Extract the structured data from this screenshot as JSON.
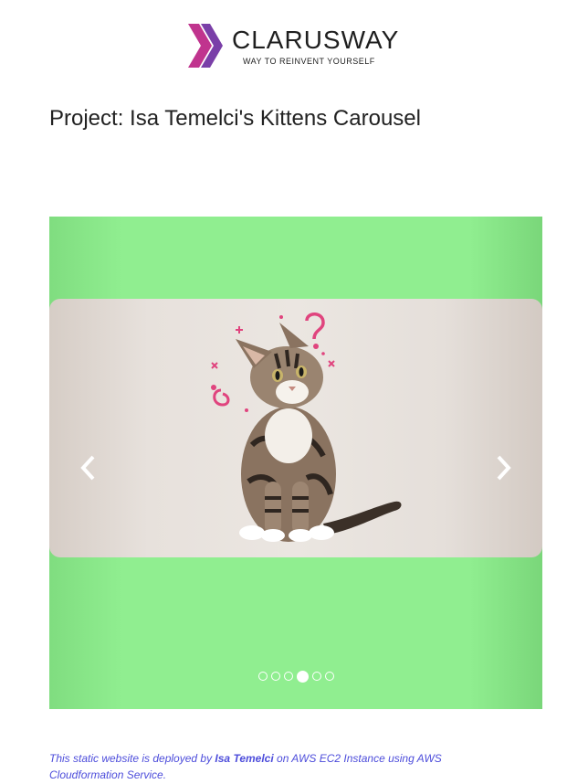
{
  "logo": {
    "name": "CLARUSWAY",
    "tagline": "WAY TO REINVENT YOURSELF"
  },
  "heading": "Project: Isa Temelci's Kittens Carousel",
  "carousel": {
    "background_color": "#90ee90",
    "slide_count": 6,
    "active_index": 3,
    "slide_image": "cat-photo",
    "prev_icon": "chevron-left-icon",
    "next_icon": "chevron-right-icon"
  },
  "footer": {
    "prefix": "This static website is deployed by ",
    "author": "Isa Temelci",
    "suffix": " on AWS EC2 Instance using AWS Cloudformation Service.",
    "color": "#4d4ddb"
  }
}
